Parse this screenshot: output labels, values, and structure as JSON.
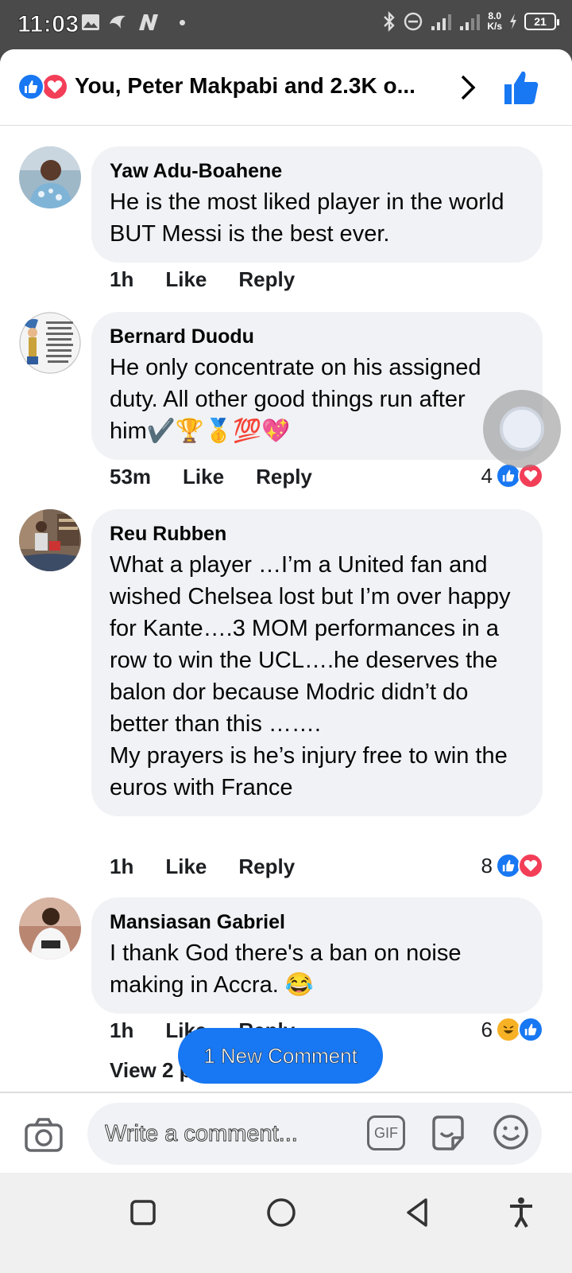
{
  "status_bar": {
    "time": "11:03",
    "net_speed_value": "8.0",
    "net_speed_unit": "K/s",
    "battery": "21"
  },
  "header": {
    "text": "You, Peter Makpabi and 2.3K o...",
    "icons": [
      "like-icon",
      "love-icon",
      "chevron-right-icon",
      "thumbs-up-icon"
    ]
  },
  "comments": [
    {
      "author": "Yaw Adu-Boahene",
      "text": "He is the most liked player in the world BUT Messi is the best ever.",
      "time": "1h",
      "like_label": "Like",
      "reply_label": "Reply"
    },
    {
      "author": "Bernard Duodu",
      "text": "He only concentrate on his assigned duty. All other good things run after him✔️🏆🥇💯💖",
      "time": "53m",
      "like_label": "Like",
      "reply_label": "Reply",
      "reaction_count": "4",
      "reactions": [
        "like",
        "love"
      ]
    },
    {
      "author": "Reu Rubben",
      "text": "What a player …I’m a United fan and wished Chelsea lost but I’m over happy for Kante….3 MOM performances in a row to win the UCL….he deserves the balon dor because Modric didn’t do better than this …….\nMy prayers is he’s injury free to win the euros with France",
      "time": "1h",
      "like_label": "Like",
      "reply_label": "Reply",
      "reaction_count": "8",
      "reactions": [
        "like",
        "love"
      ]
    },
    {
      "author": "Mansiasan Gabriel",
      "text": "I thank God there's a ban on noise making in Accra. 😂",
      "time": "1h",
      "like_label": "Like",
      "reply_label": "Reply",
      "reaction_count": "6",
      "reactions": [
        "haha",
        "like"
      ]
    }
  ],
  "view_replies": "View 2 p",
  "new_comment_button": "1 New Comment",
  "composer": {
    "placeholder": "Write a comment...",
    "gif_label": "GIF"
  },
  "colors": {
    "facebook_blue": "#1877f2",
    "love_red": "#f33e58",
    "bubble_bg": "#f0f2f5"
  }
}
